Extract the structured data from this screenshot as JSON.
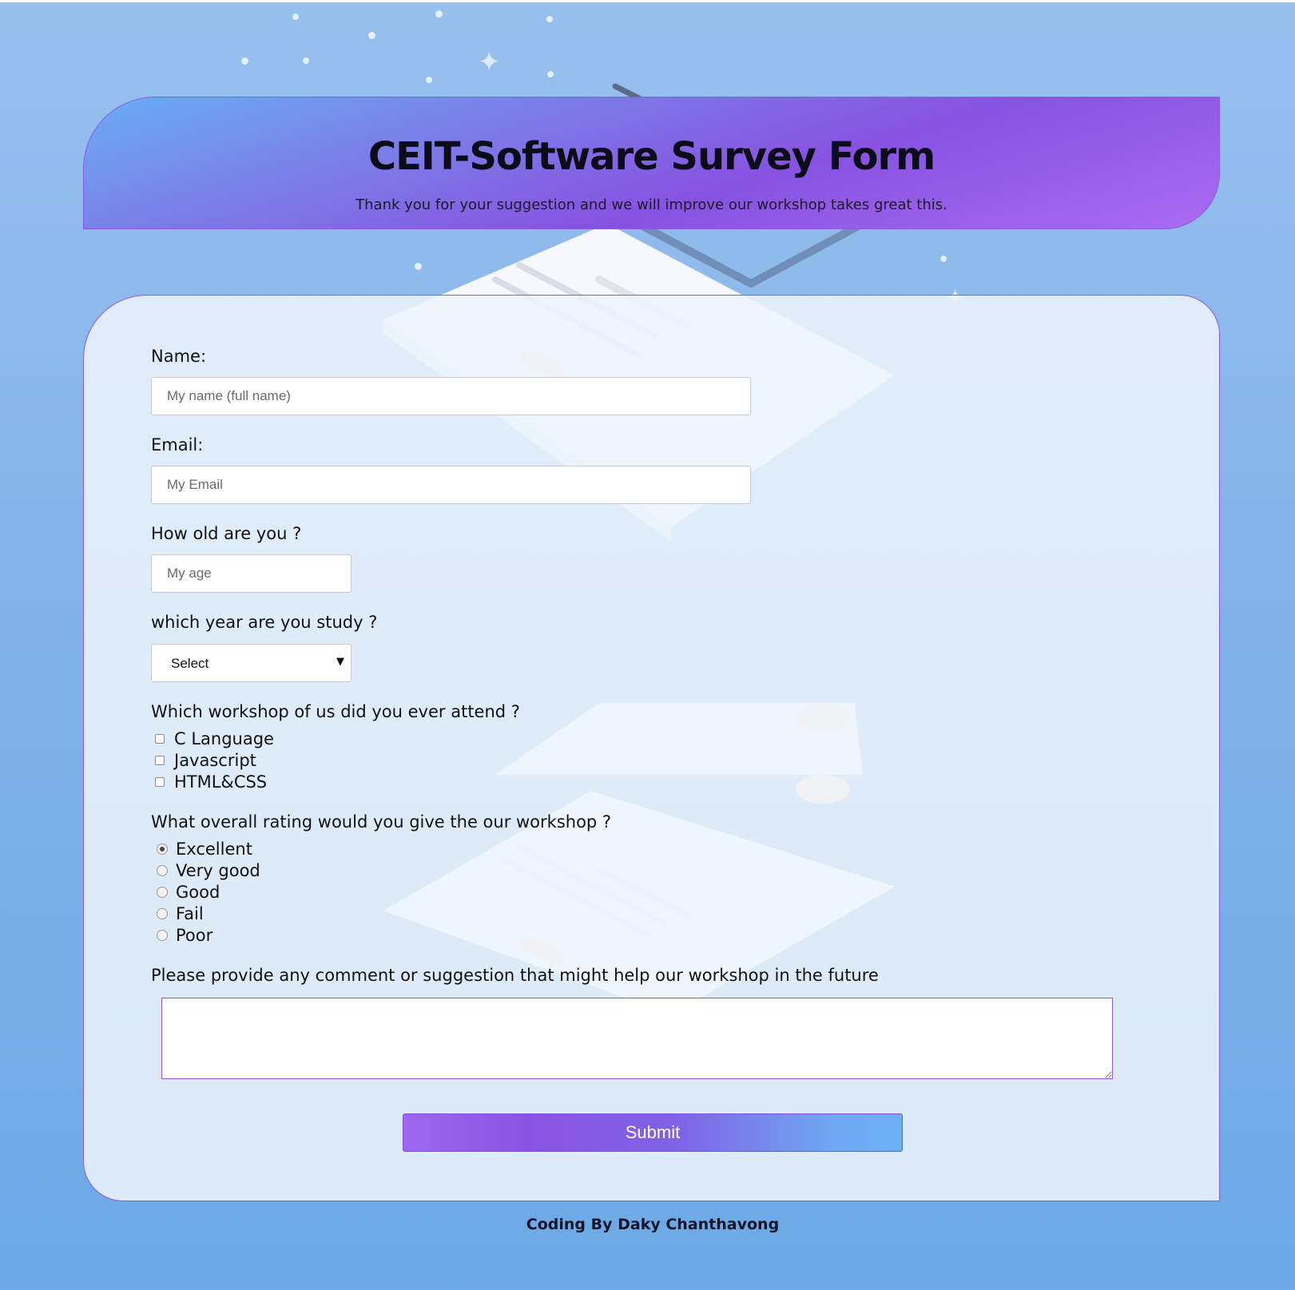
{
  "header": {
    "title": "CEIT-Software Survey Form",
    "subtitle": "Thank you for your suggestion and we will improve our workshop takes great this."
  },
  "form": {
    "name": {
      "label": "Name:",
      "placeholder": "My name (full name)"
    },
    "email": {
      "label": "Email:",
      "placeholder": "My Email"
    },
    "age": {
      "label": "How old are you ?",
      "placeholder": "My age"
    },
    "year": {
      "label": "which year are you study ?",
      "selected": "Select"
    },
    "workshops": {
      "label": "Which workshop of us did you ever attend ?",
      "options": [
        "C Language",
        "Javascript",
        "HTML&CSS"
      ]
    },
    "rating": {
      "label": "What overall rating would you give the our workshop ?",
      "options": [
        "Excellent",
        "Very good",
        "Good",
        "Fail",
        "Poor"
      ],
      "selected": "Excellent"
    },
    "comment": {
      "label": "Please provide any comment or suggestion that might help our workshop in the future",
      "value": ""
    },
    "submit_label": "Submit"
  },
  "footer": {
    "text": "Coding By Daky Chanthavong"
  },
  "colors": {
    "accent_purple": "#8752e1",
    "accent_blue": "#69aef4",
    "background": "#86b4ea"
  }
}
